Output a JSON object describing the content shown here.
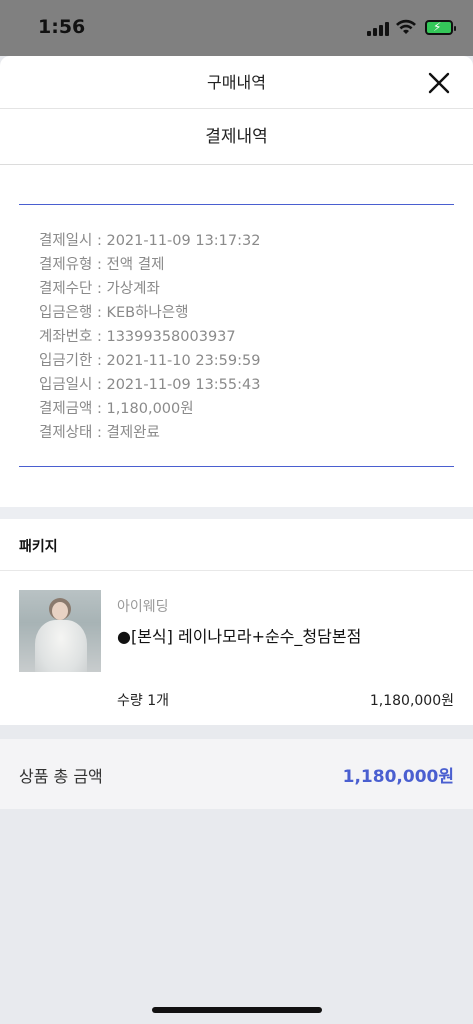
{
  "status_bar": {
    "time": "1:56",
    "icons": [
      "cellular-signal-icon",
      "wifi-icon",
      "battery-charging-icon"
    ],
    "battery_color": "#34c759"
  },
  "header": {
    "title": "구매내역",
    "close_icon": "close-icon"
  },
  "payment_section": {
    "title": "결제내역",
    "details": [
      "결제일시 : 2021-11-09 13:17:32",
      "결제유형 : 전액 결제",
      "결제수단 : 가상계좌",
      "입금은행 : KEB하나은행",
      "계좌번호 : 13399358003937",
      "입금기한 : 2021-11-10 23:59:59",
      "입금일시 : 2021-11-09 13:55:43",
      "결제금액 : 1,180,000원",
      "결제상태 : 결제완료"
    ],
    "divider_color": "#4a5fd0"
  },
  "package_section": {
    "header": "패키지",
    "item": {
      "brand": "아이웨딩",
      "name": "●[본식] 레이나모라+순수_청담본점",
      "quantity": "수량 1개",
      "price": "1,180,000원"
    }
  },
  "total": {
    "label": "상품 총 금액",
    "value": "1,180,000원",
    "accent_color": "#4a5fd0"
  }
}
